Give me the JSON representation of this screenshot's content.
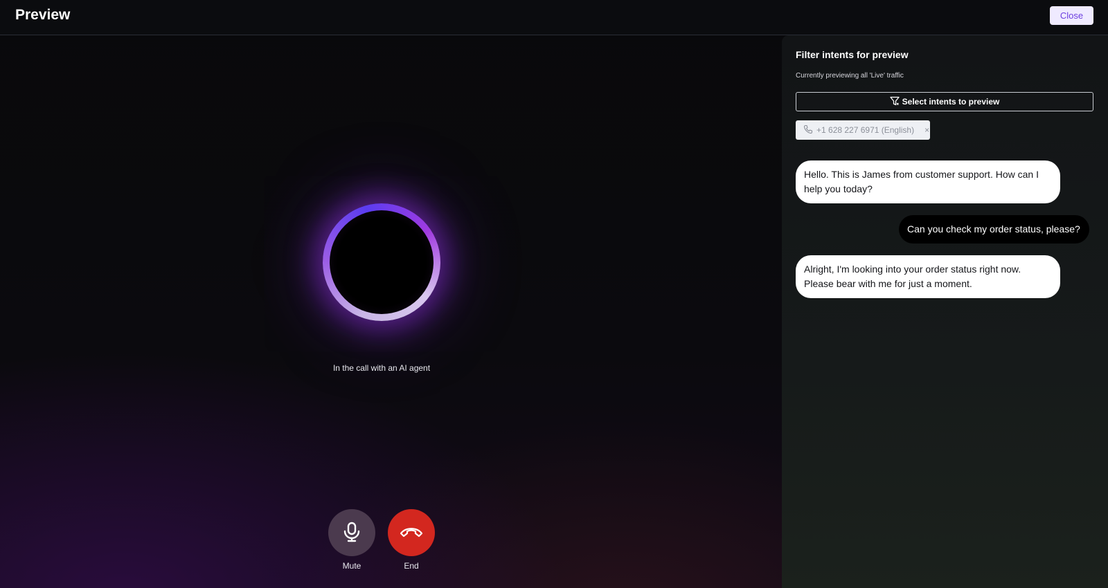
{
  "header": {
    "title": "Preview",
    "close_label": "Close"
  },
  "call": {
    "status_text": "In the call with an AI agent",
    "mute_label": "Mute",
    "end_label": "End"
  },
  "panel": {
    "title": "Filter intents for preview",
    "subtitle": "Currently previewing all 'Live' traffic",
    "select_button_label": "Select intents to preview",
    "chip_label": "+1 628 227 6971 (English)",
    "chip_remove": "×"
  },
  "conversation": [
    {
      "role": "agent",
      "text": "Hello. This is James from customer support. How can I help you today?"
    },
    {
      "role": "user",
      "text": "Can you check my order status, please?"
    },
    {
      "role": "agent",
      "text": "Alright, I'm looking into your order status right now. Please bear with me for just a moment."
    }
  ],
  "colors": {
    "accent": "#6d3fe0",
    "end_call": "#d3271f",
    "mute": "#4b3a4e"
  },
  "icons": [
    "filter-icon",
    "phone-icon",
    "microphone-icon",
    "hang-up-icon",
    "close-icon"
  ]
}
